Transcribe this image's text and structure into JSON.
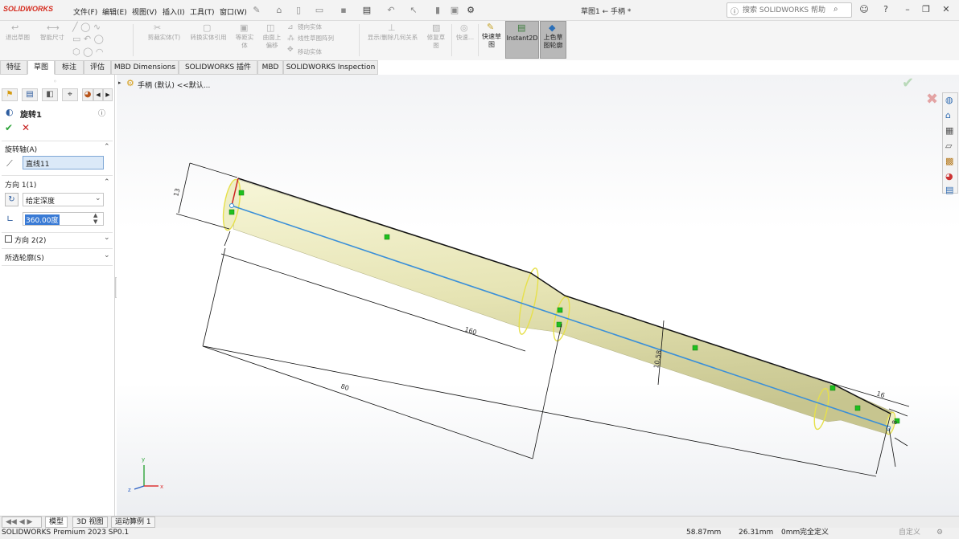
{
  "app": {
    "logo": "SOLIDWORKS",
    "doc_title": "草图1 ← 手柄 *"
  },
  "menu": [
    "文件(F)",
    "编辑(E)",
    "视图(V)",
    "插入(I)",
    "工具(T)",
    "窗口(W)"
  ],
  "search": {
    "placeholder": "搜索 SOLIDWORKS 帮助"
  },
  "ribbon": {
    "exit_sketch": "退出草图",
    "smart_dim": "智能尺寸",
    "trim": "剪裁实体(T)",
    "convert": "转换实体引用",
    "offset": "等距实\n体",
    "surface_offset": "曲面上\n偏移",
    "mirror": "镜向实体",
    "linear_pattern": "线性草图阵列",
    "move": "移动实体",
    "show_relations": "显示/删除几何关系",
    "repair": "修复草\n图",
    "quick_snaps": "快速...",
    "rapid_sketch": "快速草\n图",
    "instant2d": "Instant2D",
    "shaded_sketch": "上色草\n图轮廓"
  },
  "tabs": [
    "特征",
    "草图",
    "标注",
    "评估",
    "MBD Dimensions",
    "SOLIDWORKS 插件",
    "MBD",
    "SOLIDWORKS Inspection"
  ],
  "active_tab": "草图",
  "feature": {
    "title": "旋转1",
    "axis_label": "旋转轴(A)",
    "axis_value": "直线11",
    "direction1_label": "方向 1(1)",
    "end_condition": "给定深度",
    "angle": "360.00度",
    "direction2_label": "方向 2(2)",
    "contours_label": "所选轮廓(S)"
  },
  "tree": {
    "path": "手柄 (默认) <<默认..."
  },
  "dimensions": {
    "d13": "13",
    "d160": "160",
    "d80": "80",
    "d10_58": "10.58",
    "d16": "16",
    "d8": "8"
  },
  "triad": {
    "x": "x",
    "y": "y",
    "z": "z"
  },
  "bottom_tabs": [
    "模型",
    "3D 视图",
    "运动算例 1"
  ],
  "status": {
    "version": "SOLIDWORKS Premium 2023 SP0.1",
    "x": "58.87mm",
    "y": "26.31mm",
    "z": "0mm",
    "state": "完全定义",
    "mode": "自定义"
  },
  "colors": {
    "accent_red": "#d52b1e",
    "model_fill": "#ecebc0",
    "axis_line": "#3a8fd8",
    "relation_green": "#1ec01e"
  }
}
